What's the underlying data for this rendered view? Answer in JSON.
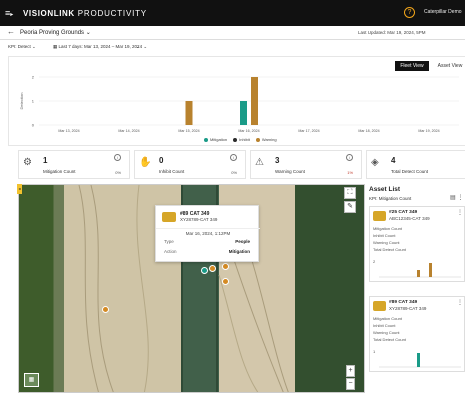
{
  "topbar": {
    "menu_icon": "≡",
    "chevron_icon": "▸",
    "brand": "VISIONLINK",
    "brand_sub": "PRODUCTIVITY",
    "help_icon": "?",
    "account": "Caterpillar Demo"
  },
  "sitebar": {
    "back_icon": "←",
    "site_name": "Peoria Proving Grounds ⌄",
    "last_updated": "Last Updated: Mar 19, 2024, 5PM"
  },
  "filters": {
    "kpi": "KPI: Detect ⌄",
    "range": "Last 7 days: Mar 13, 2024 – Mar 19, 2024 ⌄",
    "extra": "⌄"
  },
  "chart_data": {
    "type": "bar",
    "categories": [
      "Mar 13, 2024",
      "Mar 14, 2024",
      "Mar 15, 2024",
      "Mar 16, 2024",
      "Mar 17, 2024",
      "Mar 18, 2024",
      "Mar 19, 2024"
    ],
    "series": [
      {
        "name": "Mitigation",
        "values": [
          0,
          0,
          0,
          1,
          0,
          0,
          0
        ],
        "color": "#1a9b88"
      },
      {
        "name": "Inhibit",
        "values": [
          0,
          0,
          0,
          0,
          0,
          0,
          0
        ],
        "color": "#2b2b2b"
      },
      {
        "name": "Warning",
        "values": [
          0,
          0,
          1,
          2,
          0,
          0,
          0
        ],
        "color": "#b8822e"
      }
    ],
    "ylabel": "Detection",
    "yticks": [
      "0",
      "1",
      "2"
    ],
    "ylim": [
      0,
      2
    ],
    "legend": "bottom-center",
    "grid": true
  },
  "view_toggle": {
    "fleet": "Fleet View",
    "asset": "Asset View"
  },
  "cards": [
    {
      "value": "1",
      "label": "Mitigation Count",
      "pct": "0%",
      "icon": "person-shield-icon",
      "glyph": "⚙"
    },
    {
      "value": "0",
      "label": "Inhibit Count",
      "pct": "0%",
      "icon": "hand-icon",
      "glyph": "✋"
    },
    {
      "value": "3",
      "label": "Warning Count",
      "pct": "1%",
      "icon": "warning-icon",
      "glyph": "⚠"
    },
    {
      "value": "4",
      "label": "Total Detect Count",
      "pct": "",
      "icon": "detect-icon",
      "glyph": "◈"
    }
  ],
  "card_info_icon": "i",
  "map": {
    "fullscreen_icon": "⛶",
    "ruler_icon": "✎",
    "zoom_in": "+",
    "zoom_out": "−",
    "layers_icon": "▦",
    "side_tab": "◂",
    "markers": [
      {
        "color": "#d48a23"
      },
      {
        "color": "#d48a23"
      },
      {
        "color": "#d48a23"
      },
      {
        "color": "#d48a23"
      },
      {
        "color": "#1a9b88"
      }
    ]
  },
  "popup": {
    "title": "#89 CAT 349",
    "sub": "XY28789-CAT 349",
    "time": "Mar 16, 2024, 1:12PM",
    "type_key": "Type",
    "type_val": "People",
    "action_key": "Action",
    "action_val": "Mitigation"
  },
  "asset_list": {
    "title": "Asset List",
    "kpi": "KPI: Mitigation Count",
    "icons": "▤ ⋮",
    "assets": [
      {
        "name": "#25 CAT 349",
        "id": "ABC12345-CAT 349",
        "rows": [
          "Mitigation Count",
          "Inhibit Count",
          "Warning Count",
          "Total Detect Count"
        ],
        "ytick": "2",
        "bars": [
          0,
          0,
          1,
          2
        ],
        "bar_colors": [
          "#b8822e",
          "#b8822e",
          "#b8822e",
          "#b8822e"
        ]
      },
      {
        "name": "#89 CAT 349",
        "id": "XY28789-CAT 349",
        "rows": [
          "Mitigation Count",
          "Inhibit Count",
          "Warning Count",
          "Total Detect Count"
        ],
        "ytick": "1",
        "bars": [
          0,
          0,
          1,
          0
        ],
        "bar_colors": [
          "#1a9b88",
          "#1a9b88",
          "#1a9b88",
          "#1a9b88"
        ]
      }
    ]
  }
}
